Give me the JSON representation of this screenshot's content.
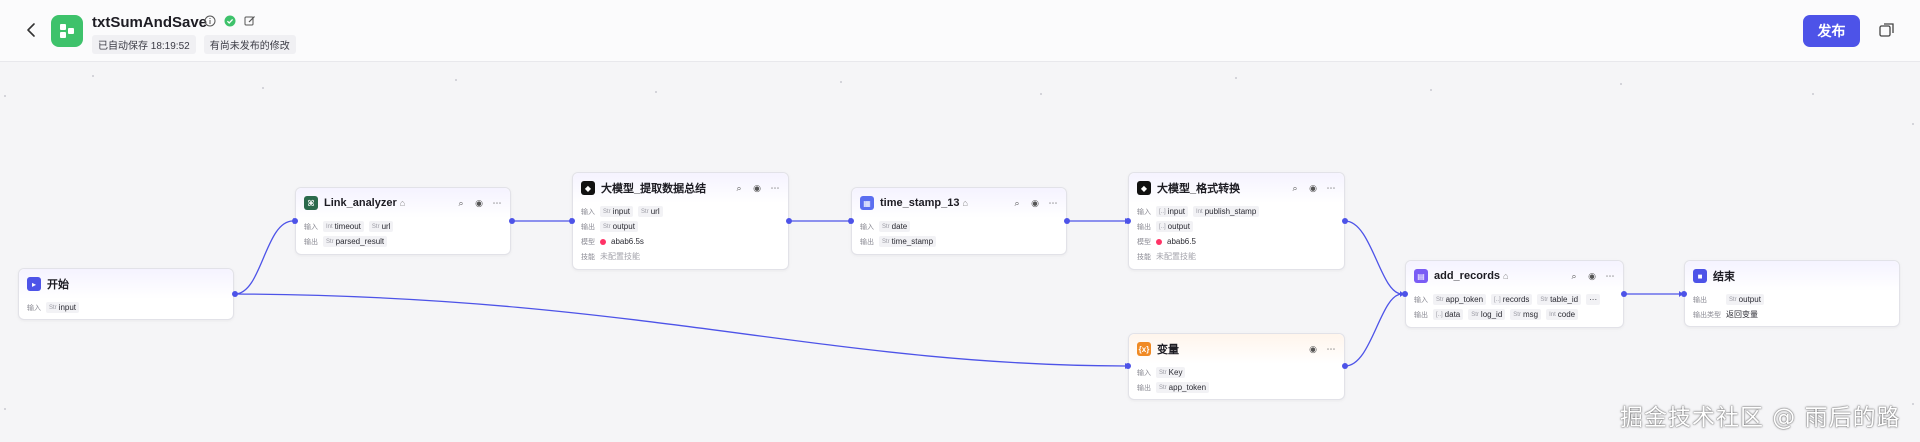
{
  "header": {
    "title": "txtSumAndSave",
    "autosave": "已自动保存 18:19:52",
    "unpublished": "有尚未发布的修改",
    "publish_label": "发布"
  },
  "colors": {
    "accent": "#4d53e8",
    "logo": "#3ec26b"
  },
  "nodes": {
    "start": {
      "title": "开始",
      "in_label": "输入",
      "input_type": "Str",
      "input_var": "input"
    },
    "link": {
      "title": "Link_analyzer",
      "in_label": "输入",
      "out_label": "输出",
      "in1_type": "Int",
      "in1": "timeout",
      "in2_type": "Str",
      "in2": "url",
      "out1_type": "Str",
      "out1": "parsed_result"
    },
    "llm1": {
      "title": "大模型_提取数据总结",
      "in_label": "输入",
      "out_label": "输出",
      "model_label": "模型",
      "skill_label": "技能",
      "in1_type": "Str",
      "in1": "input",
      "in2_type": "Str",
      "in2": "url",
      "out1_type": "Str",
      "out1": "output",
      "model": "abab6.5s",
      "skill": "未配置技能"
    },
    "ts": {
      "title": "time_stamp_13",
      "in_label": "输入",
      "out_label": "输出",
      "in1_type": "Str",
      "in1": "date",
      "out1_type": "Str",
      "out1": "time_stamp"
    },
    "llm2": {
      "title": "大模型_格式转换",
      "in_label": "输入",
      "out_label": "输出",
      "model_label": "模型",
      "skill_label": "技能",
      "in1_type": "[..]",
      "in1": "input",
      "in2_type": "Int",
      "in2": "publish_stamp",
      "out1_type": "[..]",
      "out1": "output",
      "model": "abab6.5",
      "skill": "未配置技能"
    },
    "var": {
      "title": "变量",
      "in_label": "输入",
      "out_label": "输出",
      "in1_type": "Str",
      "in1": "Key",
      "out1_type": "Str",
      "out1": "app_token"
    },
    "records": {
      "title": "add_records",
      "in_label": "输入",
      "out_label": "输出",
      "in1_type": "Str",
      "in1": "app_token",
      "in2_type": "[..]",
      "in2": "records",
      "in3_type": "Str",
      "in3": "table_id",
      "more": "···",
      "out1_type": "[..]",
      "out1": "data",
      "out2_type": "Str",
      "out2": "log_id",
      "out3_type": "Str",
      "out3": "msg",
      "out4_type": "Int",
      "out4": "code"
    },
    "end": {
      "title": "结束",
      "out_label": "输出",
      "mode_label": "输出类型",
      "out1_type": "Str",
      "out1": "output",
      "mode": "返回变量"
    }
  },
  "watermark": "掘金技术社区 @ 雨后的路"
}
